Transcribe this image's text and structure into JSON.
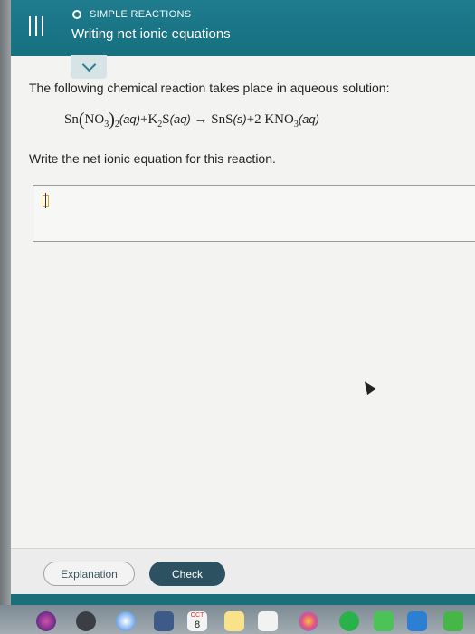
{
  "header": {
    "topic_label": "SIMPLE REACTIONS",
    "title": "Writing net ionic equations"
  },
  "question": {
    "intro": "The following chemical reaction takes place in aqueous solution:",
    "prompt": "Write the net ionic equation for this reaction.",
    "equation": {
      "reactant1_formula": "Sn",
      "reactant1_group": "NO",
      "reactant1_group_sub": "3",
      "reactant1_group_count": "2",
      "reactant1_state": "(aq)",
      "plus1": "+",
      "reactant2_k": "K",
      "reactant2_sub": "2",
      "reactant2_s": "S",
      "reactant2_state": "(aq)",
      "arrow": "→",
      "product1": "SnS",
      "product1_state": "(s)",
      "plus2": "+",
      "coef": "2",
      "product2": "KNO",
      "product2_sub": "3",
      "product2_state": "(aq)"
    }
  },
  "answer_box": {
    "value": ""
  },
  "footer": {
    "explanation_label": "Explanation",
    "check_label": "Check"
  },
  "dock": {
    "calendar_month": "OCT",
    "calendar_day": "8"
  },
  "colors": {
    "header": "#1b7586",
    "check_button": "#2c5160",
    "accent": "#2a7f95"
  }
}
